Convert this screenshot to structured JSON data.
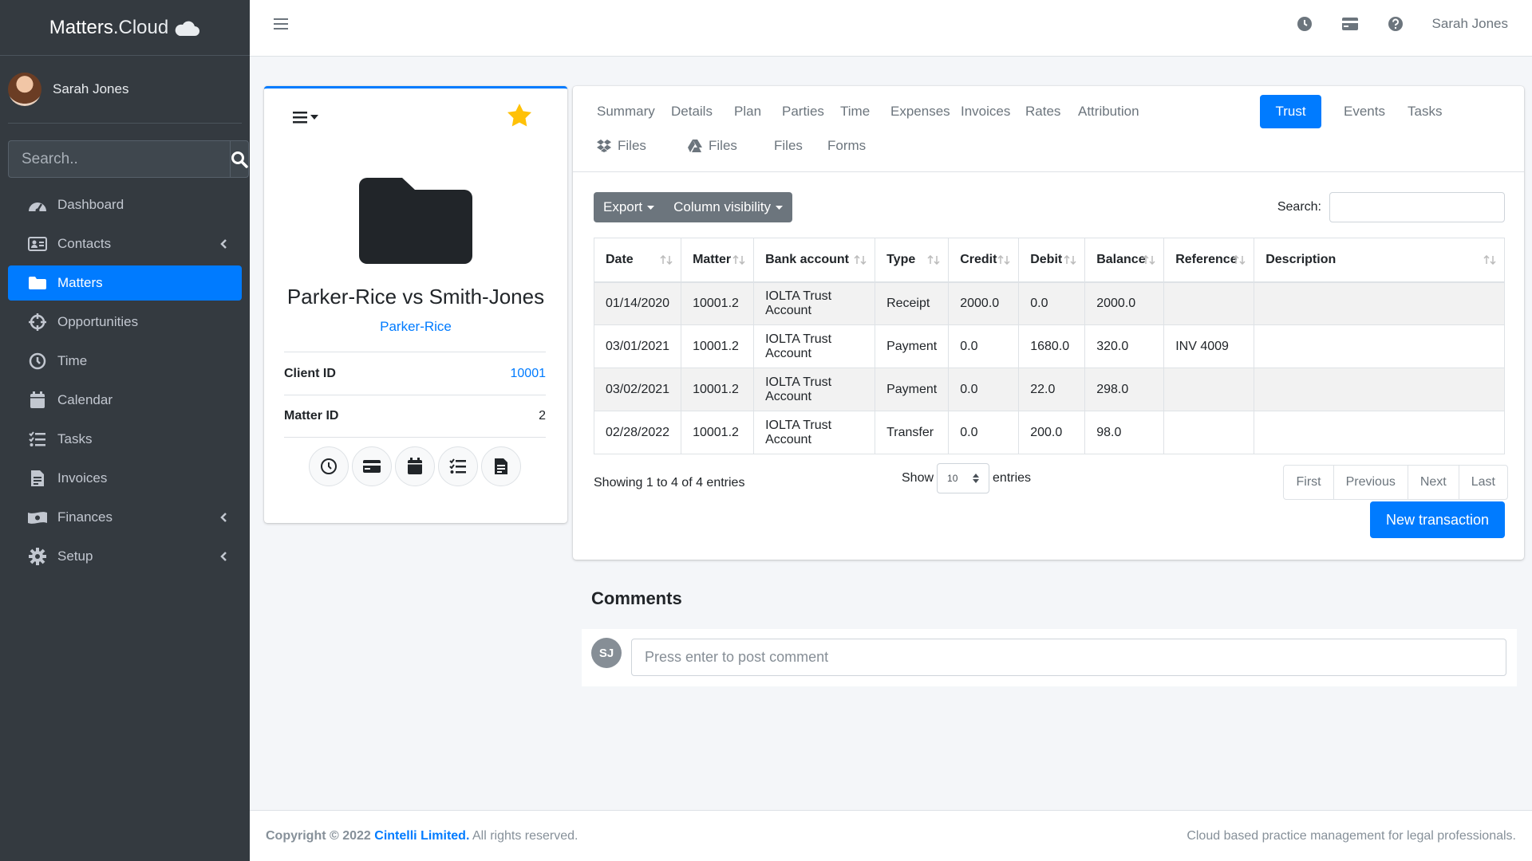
{
  "brand": {
    "part1": "Matters",
    "part2": ".Cloud"
  },
  "sidebar": {
    "user_name": "Sarah Jones",
    "search_placeholder": "Search..",
    "items": [
      {
        "label": "Dashboard",
        "icon": "tachometer-icon"
      },
      {
        "label": "Contacts",
        "icon": "address-card-icon"
      },
      {
        "label": "Matters",
        "icon": "folder-icon"
      },
      {
        "label": "Opportunities",
        "icon": "crosshairs-icon"
      },
      {
        "label": "Time",
        "icon": "clock-icon"
      },
      {
        "label": "Calendar",
        "icon": "calendar-icon"
      },
      {
        "label": "Tasks",
        "icon": "tasks-icon"
      },
      {
        "label": "Invoices",
        "icon": "file-invoice-icon"
      },
      {
        "label": "Finances",
        "icon": "money-icon"
      },
      {
        "label": "Setup",
        "icon": "gear-icon"
      }
    ]
  },
  "header": {
    "user_name": "Sarah Jones"
  },
  "matter": {
    "title": "Parker-Rice vs Smith-Jones",
    "client": "Parker-Rice",
    "client_id_label": "Client ID",
    "client_id": "10001",
    "matter_id_label": "Matter ID",
    "matter_id": "2"
  },
  "tabs": {
    "row1": [
      "Summary",
      "Details",
      "Plan",
      "Parties",
      "Time",
      "Expenses",
      "Invoices",
      "Rates",
      "Attribution",
      "Trust",
      "Events",
      "Tasks"
    ],
    "row2": [
      "Files",
      "Files",
      "Files",
      "Forms"
    ],
    "active": "Trust"
  },
  "toolbar": {
    "export": "Export",
    "column_visibility": "Column visibility",
    "search_label": "Search:"
  },
  "table": {
    "headers": [
      "Date",
      "Matter",
      "Bank account",
      "Type",
      "Credit",
      "Debit",
      "Balance",
      "Reference",
      "Description"
    ],
    "rows": [
      [
        "01/14/2020",
        "10001.2",
        "IOLTA Trust Account",
        "Receipt",
        "2000.0",
        "0.0",
        "2000.0",
        "",
        ""
      ],
      [
        "03/01/2021",
        "10001.2",
        "IOLTA Trust Account",
        "Payment",
        "0.0",
        "1680.0",
        "320.0",
        "INV 4009",
        ""
      ],
      [
        "03/02/2021",
        "10001.2",
        "IOLTA Trust Account",
        "Payment",
        "0.0",
        "22.0",
        "298.0",
        "",
        ""
      ],
      [
        "02/28/2022",
        "10001.2",
        "IOLTA Trust Account",
        "Transfer",
        "0.0",
        "200.0",
        "98.0",
        "",
        ""
      ]
    ]
  },
  "pagination": {
    "info": "Showing 1 to 4 of 4 entries",
    "show": "Show",
    "entries": "entries",
    "page_length": "10",
    "first": "First",
    "previous": "Previous",
    "next": "Next",
    "last": "Last"
  },
  "new_transaction": "New transaction",
  "comments": {
    "title": "Comments",
    "initials": "SJ",
    "placeholder": "Press enter to post comment"
  },
  "footer": {
    "copyright": "Copyright © 2022",
    "company": "Cintelli Limited.",
    "rights": "All rights reserved.",
    "tagline": "Cloud based practice management for legal professionals."
  },
  "colors": {
    "primary": "#007bff",
    "sidebar": "#343a40",
    "star": "#ffc107"
  }
}
